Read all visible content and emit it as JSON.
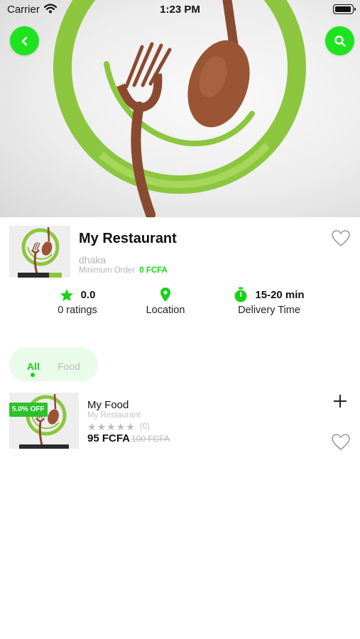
{
  "status_bar": {
    "carrier": "Carrier",
    "time": "1:23 PM"
  },
  "restaurant": {
    "name": "My Restaurant",
    "city": "dhaka",
    "min_order_label": "Minimum Order",
    "min_order_value": "0 FCFA"
  },
  "stats": {
    "rating_value": "0.0",
    "rating_label": "0 ratings",
    "location_label": "Location",
    "delivery_value": "15-20 min",
    "delivery_label": "Delivery Time"
  },
  "tabs": [
    {
      "label": "All",
      "active": true
    },
    {
      "label": "Food",
      "active": false
    }
  ],
  "food_items": [
    {
      "name": "My Food",
      "restaurant": "My Restaurant",
      "discount": "5.0% OFF",
      "stars": 0,
      "rating_count": "(0)",
      "price": "95 FCFA",
      "old_price": "100 FCFA"
    }
  ],
  "colors": {
    "accent": "#1ee31e",
    "accent_text": "#19d819",
    "tab_bg": "#e9fbe9",
    "badge": "#2dc12d"
  },
  "icons": [
    "wifi-icon",
    "battery-icon",
    "back-arrow-icon",
    "search-icon",
    "heart-icon",
    "star-icon",
    "location-pin-icon",
    "stopwatch-icon",
    "plus-icon"
  ]
}
